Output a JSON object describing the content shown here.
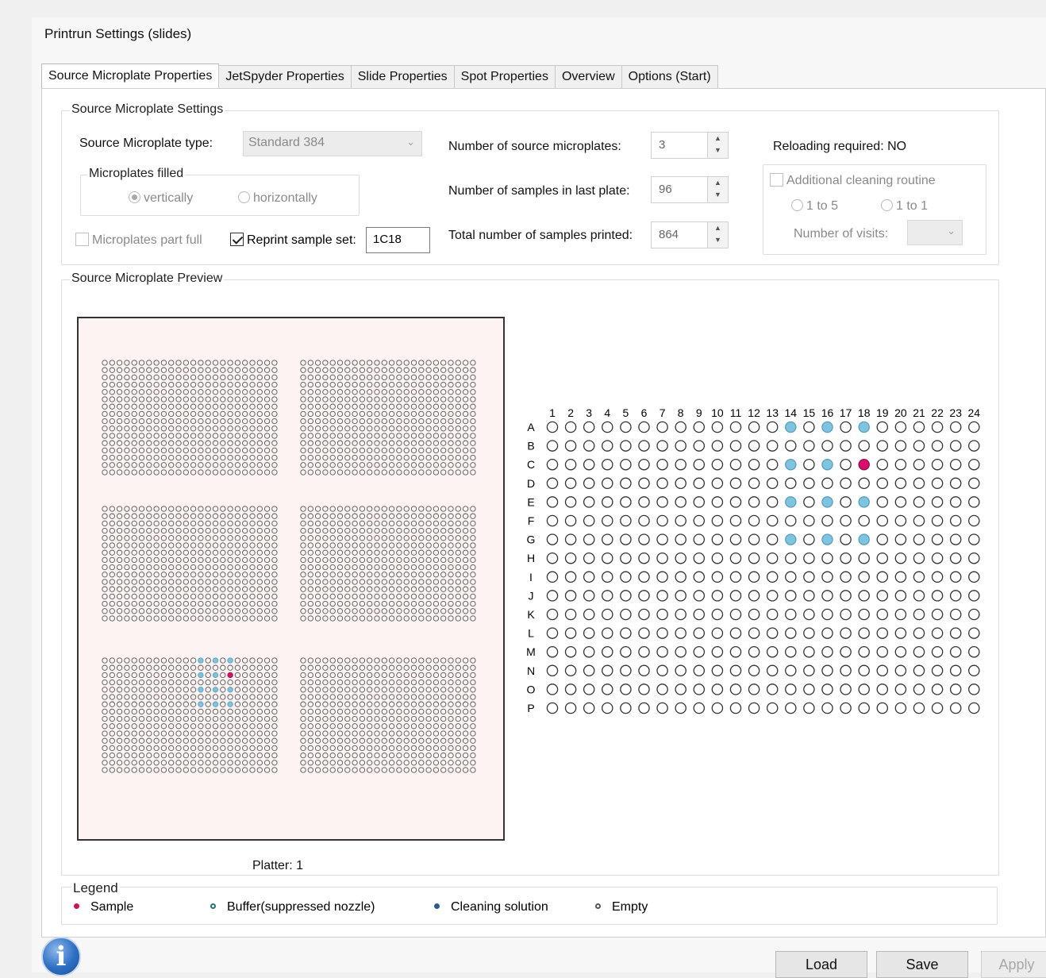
{
  "window": {
    "title": "Printrun Settings  (slides)"
  },
  "tabs": [
    {
      "label": "Source Microplate Properties",
      "active": true
    },
    {
      "label": "JetSpyder Properties"
    },
    {
      "label": "Slide Properties"
    },
    {
      "label": "Spot Properties"
    },
    {
      "label": "Overview"
    },
    {
      "label": "Options (Start)"
    }
  ],
  "settings": {
    "group_title": "Source Microplate Settings",
    "type_label": "Source Microplate type:",
    "type_value": "Standard 384",
    "filled_group": "Microplates filled",
    "vertically": "vertically",
    "horizontally": "horizontally",
    "part_full": "Microplates part full",
    "reprint_label": "Reprint sample set:",
    "reprint_value": "1C18",
    "num_plates_label": "Number of source microplates:",
    "num_plates_value": "3",
    "num_last_label": "Number of samples in last plate:",
    "num_last_value": "96",
    "total_label": "Total number of samples printed:",
    "total_value": "864",
    "reloading": "Reloading required: NO",
    "additional_cleaning": "Additional cleaning routine",
    "one_to_five": "1 to 5",
    "one_to_one": "1 to 1",
    "visits_label": "Number of visits:"
  },
  "preview": {
    "group_title": "Source Microplate Preview",
    "platter_label": "Platter: 1",
    "col_labels": [
      "1",
      "2",
      "3",
      "4",
      "5",
      "6",
      "7",
      "8",
      "9",
      "10",
      "11",
      "12",
      "13",
      "14",
      "15",
      "16",
      "17",
      "18",
      "19",
      "20",
      "21",
      "22",
      "23",
      "24"
    ],
    "row_labels": [
      "A",
      "B",
      "C",
      "D",
      "E",
      "F",
      "G",
      "H",
      "I",
      "J",
      "K",
      "L",
      "M",
      "N",
      "O",
      "P"
    ],
    "cleaning_wells": [
      "A14",
      "A16",
      "A18",
      "C14",
      "C16",
      "E14",
      "E16",
      "E18",
      "G14",
      "G16",
      "G18"
    ],
    "sample_wells": [
      "C18"
    ]
  },
  "legend": {
    "title": "Legend",
    "items": [
      {
        "label": "Sample",
        "color": "#c2185b"
      },
      {
        "label": "Buffer(suppressed nozzle)",
        "color": "#2a6f7a"
      },
      {
        "label": "Cleaning solution",
        "color": "#2a5c8a"
      },
      {
        "label": "Empty",
        "color": "#555555"
      }
    ]
  },
  "colors": {
    "cleaning": "#7fc4df",
    "sample": "#d6106b",
    "empty_stroke": "#333333"
  },
  "buttons": {
    "load": "Load",
    "save": "Save",
    "apply": "Apply"
  },
  "info_glyph": "i"
}
